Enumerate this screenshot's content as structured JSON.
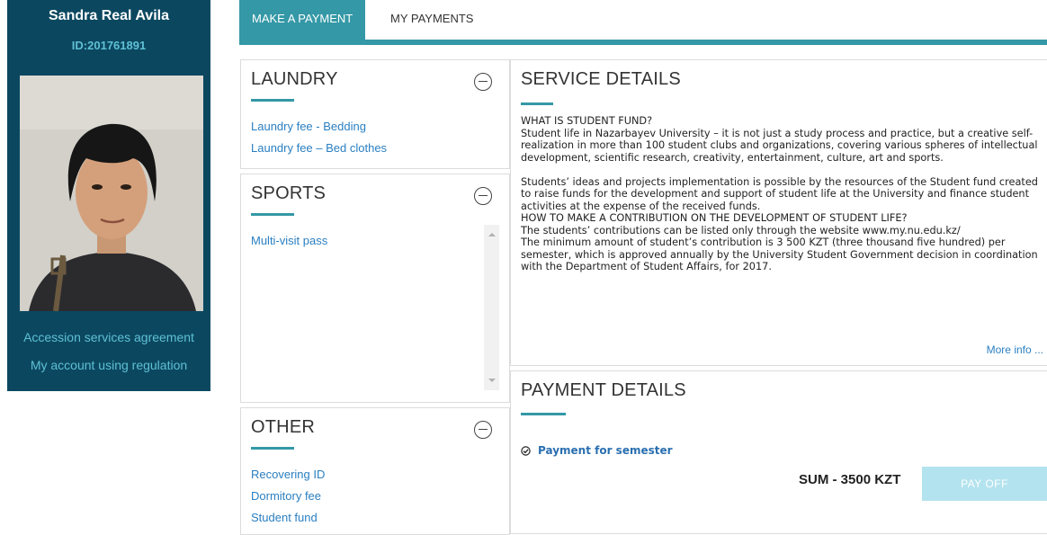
{
  "profile": {
    "name": "Sandra Real Avila",
    "id": "ID:201761891",
    "links": [
      "Accession services agreement",
      "My account using regulation"
    ]
  },
  "tabs": [
    {
      "label": "MAKE A PAYMENT",
      "active": true
    },
    {
      "label": "MY PAYMENTS",
      "active": false
    }
  ],
  "categories": {
    "laundry": {
      "title": "LAUNDRY",
      "items": [
        "Laundry fee - Bedding",
        "Laundry fee – Bed clothes"
      ]
    },
    "sports": {
      "title": "SPORTS",
      "items": [
        "Multi-visit pass"
      ]
    },
    "other": {
      "title": "OTHER",
      "items": [
        "Recovering ID",
        "Dormitory fee",
        "Student fund"
      ]
    }
  },
  "service_details": {
    "title": "SERVICE DETAILS",
    "para1": "WHAT IS STUDENT FUND?\nStudent life in Nazarbayev University – it is not just a study process and practice, but a creative self-realization in more than 100 student clubs and organizations, covering various spheres of intellectual development, scientific research, creativity, entertainment, culture, art and sports.",
    "para2": "Students’ ideas and projects implementation is possible by the resources of the Student fund created to raise funds for the development and support of student life at the University and finance student activities at the expense of the received funds.\nHOW TO MAKE A CONTRIBUTION ON THE DEVELOPMENT OF STUDENT LIFE?\nThe students’ contributions can be listed only through the website www.my.nu.edu.kz/\nThe minimum amount of student’s contribution is 3 500 KZT (three thousand five hundred) per semester, which is approved annually by the University Student Government decision in coordination with the Department of Student Affairs, for 2017.",
    "more_label": "More info ..."
  },
  "payment_details": {
    "title": "PAYMENT DETAILS",
    "option": "Payment for semester",
    "sum": "SUM - 3500 KZT",
    "button": "PAY OFF"
  },
  "colors": {
    "sidebar": "#0b4860",
    "accent": "#3498a6",
    "link": "#2a7fc1",
    "button_disabled": "#b3e3ee"
  }
}
